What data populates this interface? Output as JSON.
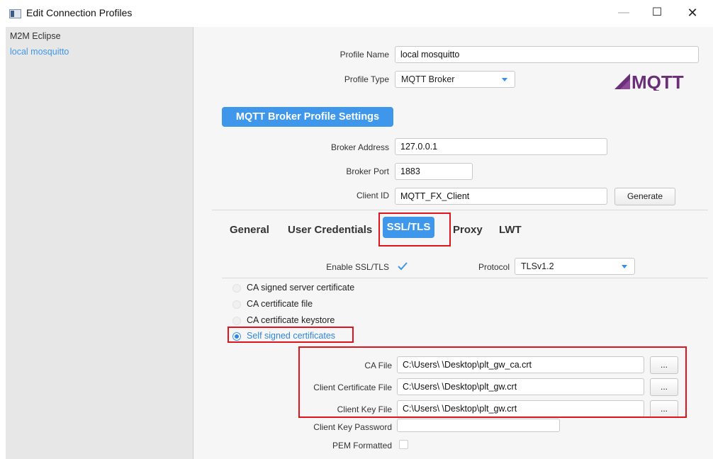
{
  "window": {
    "title": "Edit Connection Profiles",
    "minimize": "—",
    "maximize": "☐",
    "close": "✕"
  },
  "sidebar": {
    "items": [
      {
        "label": "M2M Eclipse",
        "selected": false
      },
      {
        "label": "local mosquitto",
        "selected": true
      }
    ]
  },
  "profile": {
    "name_label": "Profile Name",
    "name_value": "local mosquitto",
    "type_label": "Profile Type",
    "type_value": "MQTT Broker",
    "logo_text": "MQTT"
  },
  "broker": {
    "header": "MQTT Broker Profile Settings",
    "address_label": "Broker Address",
    "address_value": "127.0.0.1",
    "port_label": "Broker Port",
    "port_value": "1883",
    "client_id_label": "Client ID",
    "client_id_value": "MQTT_FX_Client",
    "generate_label": "Generate"
  },
  "tabs": [
    {
      "label": "General",
      "active": false
    },
    {
      "label": "User Credentials",
      "active": false
    },
    {
      "label": "SSL/TLS",
      "active": true
    },
    {
      "label": "Proxy",
      "active": false
    },
    {
      "label": "LWT",
      "active": false
    }
  ],
  "ssl": {
    "enable_label": "Enable SSL/TLS",
    "enable_checked": true,
    "protocol_label": "Protocol",
    "protocol_value": "TLSv1.2",
    "options": [
      {
        "label": "CA signed server certificate",
        "selected": false
      },
      {
        "label": "CA certificate file",
        "selected": false
      },
      {
        "label": "CA certificate keystore",
        "selected": false
      },
      {
        "label": "Self signed certificates",
        "selected": true
      }
    ],
    "ca_file_label": "CA File",
    "ca_file_value": "C:\\Users\\                 \\Desktop\\plt_gw_ca.crt",
    "client_cert_label": "Client Certificate File",
    "client_cert_value": "C:\\Users\\                 \\Desktop\\plt_gw.crt",
    "client_key_label": "Client Key File",
    "client_key_value": "C:\\Users\\                 \\Desktop\\plt_gw.crt",
    "browse_label": "...",
    "key_password_label": "Client Key Password",
    "key_password_value": "",
    "pem_label": "PEM Formatted",
    "pem_checked": false
  },
  "colors": {
    "accent": "#3e97ea",
    "highlight": "#e0141c",
    "sidebar_bg": "#e7e7e7",
    "panel_bg": "#f6f6f6"
  }
}
